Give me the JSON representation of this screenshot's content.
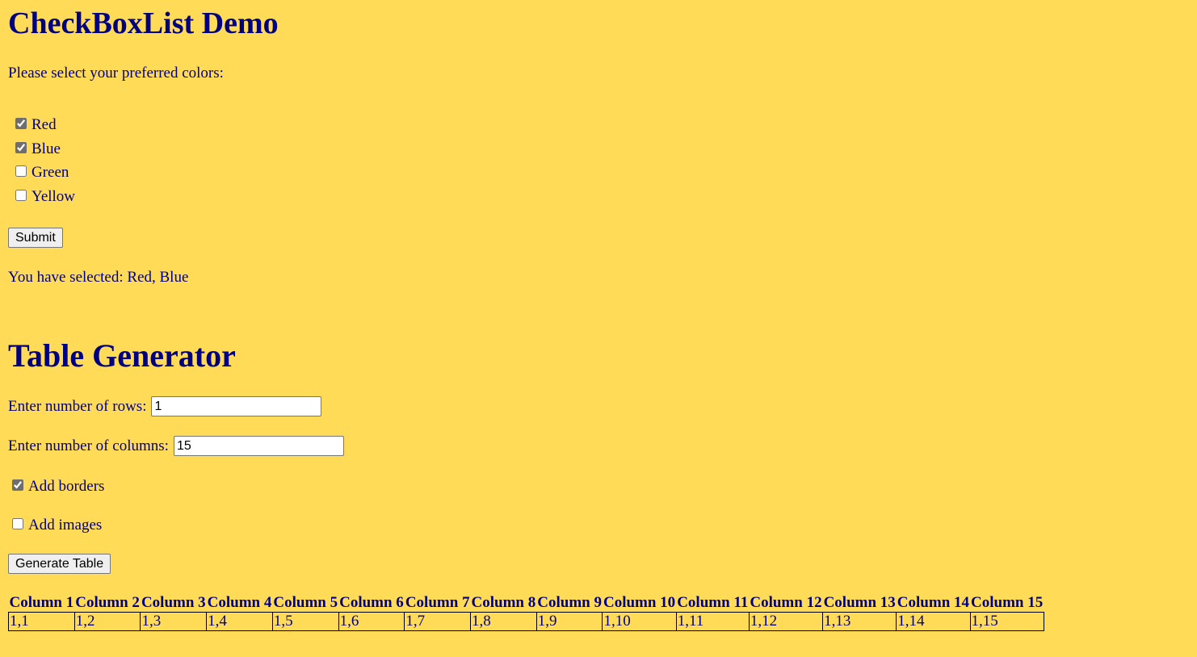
{
  "checkbox_demo": {
    "title": "CheckBoxList Demo",
    "prompt": "Please select your preferred colors:",
    "options": [
      {
        "label": "Red",
        "checked": true
      },
      {
        "label": "Blue",
        "checked": true
      },
      {
        "label": "Green",
        "checked": false
      },
      {
        "label": "Yellow",
        "checked": false
      }
    ],
    "submit_label": "Submit",
    "result_text": "You have selected: Red, Blue"
  },
  "table_generator": {
    "title": "Table Generator",
    "rows_label": "Enter number of rows:",
    "rows_value": "1",
    "columns_label": "Enter number of columns:",
    "columns_value": "15",
    "add_borders_label": "Add borders",
    "add_borders_checked": true,
    "add_images_label": "Add images",
    "add_images_checked": false,
    "generate_label": "Generate Table",
    "table": {
      "headers": [
        "Column 1",
        "Column 2",
        "Column 3",
        "Column 4",
        "Column 5",
        "Column 6",
        "Column 7",
        "Column 8",
        "Column 9",
        "Column 10",
        "Column 11",
        "Column 12",
        "Column 13",
        "Column 14",
        "Column 15"
      ],
      "rows": [
        [
          "1,1",
          "1,2",
          "1,3",
          "1,4",
          "1,5",
          "1,6",
          "1,7",
          "1,8",
          "1,9",
          "1,10",
          "1,11",
          "1,12",
          "1,13",
          "1,14",
          "1,15"
        ]
      ]
    }
  },
  "colors": {
    "background": "#ffdb58",
    "text": "#000080"
  }
}
